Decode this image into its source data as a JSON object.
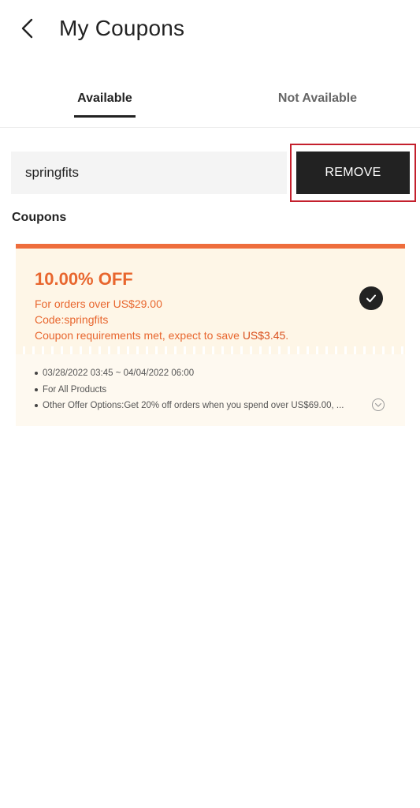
{
  "header": {
    "title": "My Coupons",
    "back_icon": "chevron-left-icon"
  },
  "tabs": [
    {
      "label": "Available",
      "active": true
    },
    {
      "label": "Not Available",
      "active": false
    }
  ],
  "code_entry": {
    "value": "springfits",
    "button_label": "REMOVE"
  },
  "section": {
    "title": "Coupons"
  },
  "coupon": {
    "discount": "10.00% OFF",
    "min_order": "For orders over US$29.00",
    "code": "Code:springfits",
    "requirement_text": "Coupon requirements met, expect to save ",
    "save_amount": "US$3.45",
    "requirement_suffix": ".",
    "selected": true,
    "details": [
      "03/28/2022  03:45 ~ 04/04/2022  06:00",
      "For All Products",
      "Other Offer Options:Get 20% off orders when you spend over US$69.00, ..."
    ],
    "accent_color": "#ee6d3c",
    "background_color": "#fef6e7"
  }
}
